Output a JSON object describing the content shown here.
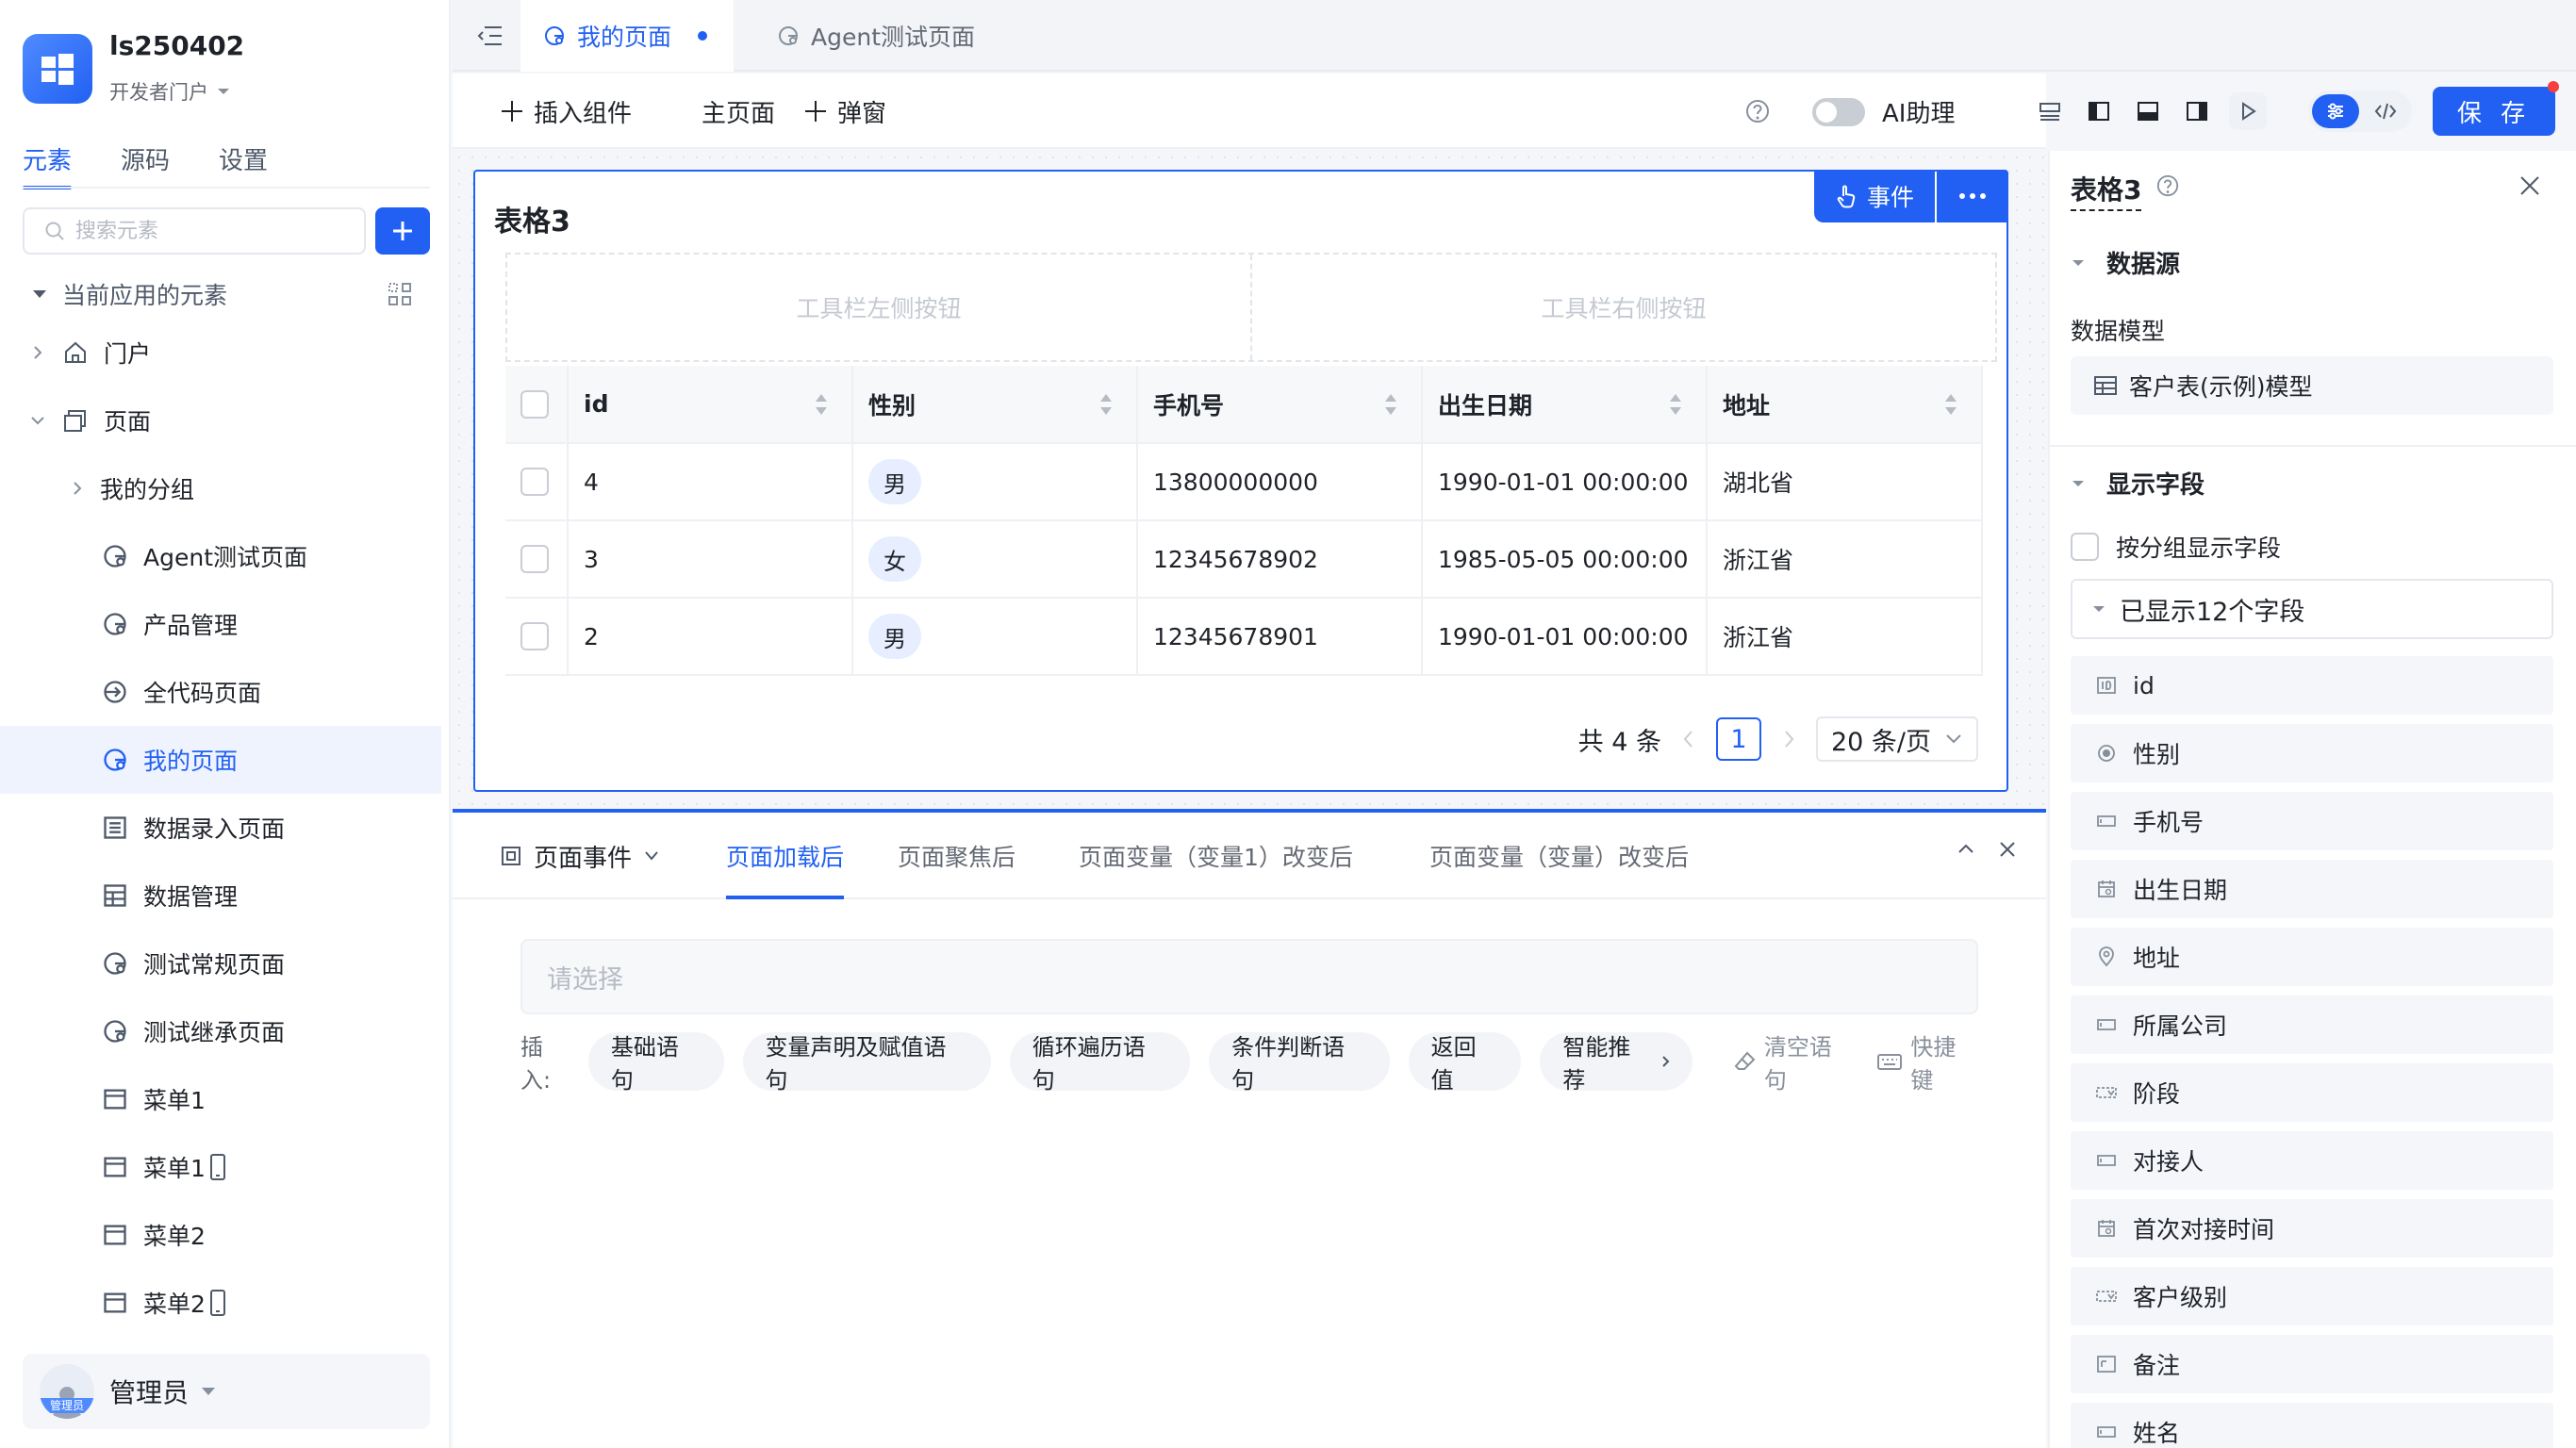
{
  "app": {
    "name": "ls250402",
    "portal": "开发者门户"
  },
  "sidebar": {
    "tabs": [
      {
        "label": "元素",
        "active": true
      },
      {
        "label": "源码",
        "active": false
      },
      {
        "label": "设置",
        "active": false
      }
    ],
    "search_placeholder": "搜索元素",
    "current_app_label": "当前应用的元素",
    "tree": {
      "portal": "门户",
      "pages": "页面",
      "group": "我的分组",
      "items": [
        {
          "label": "Agent测试页面",
          "icon": "page-icon"
        },
        {
          "label": "产品管理",
          "icon": "page-icon"
        },
        {
          "label": "全代码页面",
          "icon": "code-page-icon"
        },
        {
          "label": "我的页面",
          "icon": "page-icon",
          "selected": true
        },
        {
          "label": "数据录入页面",
          "icon": "form-icon"
        },
        {
          "label": "数据管理",
          "icon": "table-icon"
        },
        {
          "label": "测试常规页面",
          "icon": "page-icon"
        },
        {
          "label": "测试继承页面",
          "icon": "page-icon"
        },
        {
          "label": "菜单1",
          "icon": "menu-icon"
        },
        {
          "label": "菜单1",
          "icon": "menu-icon",
          "mobile": true
        },
        {
          "label": "菜单2",
          "icon": "menu-icon"
        },
        {
          "label": "菜单2",
          "icon": "menu-icon",
          "mobile": true
        }
      ]
    },
    "user": {
      "name": "管理员",
      "badge": "管理员"
    }
  },
  "tabs": [
    {
      "label": "我的页面",
      "active": true,
      "modified": true
    },
    {
      "label": "Agent测试页面",
      "active": false
    }
  ],
  "toolbar": {
    "insert_component": "插入组件",
    "main_page": "主页面",
    "popup": "弹窗",
    "ai_assistant": "AI助理",
    "save": "保 存"
  },
  "widget": {
    "title": "表格3",
    "event_label": "事件",
    "toolbar_left": "工具栏左侧按钮",
    "toolbar_right": "工具栏右侧按钮",
    "columns": [
      "id",
      "性别",
      "手机号",
      "出生日期",
      "地址"
    ],
    "rows": [
      {
        "id": "4",
        "gender": "男",
        "phone": "13800000000",
        "birth": "1990-01-01 00:00:00",
        "address": "湖北省"
      },
      {
        "id": "3",
        "gender": "女",
        "phone": "12345678902",
        "birth": "1985-05-05 00:00:00",
        "address": "浙江省"
      },
      {
        "id": "2",
        "gender": "男",
        "phone": "12345678901",
        "birth": "1990-01-01 00:00:00",
        "address": "浙江省"
      }
    ],
    "pagination": {
      "total": "共 4 条",
      "current": "1",
      "page_size": "20 条/页"
    }
  },
  "event_panel": {
    "page_event": "页面事件",
    "tabs": [
      {
        "label": "页面加载后",
        "active": true
      },
      {
        "label": "页面聚焦后",
        "active": false
      },
      {
        "label": "页面变量（变量1）改变后",
        "active": false
      },
      {
        "label": "页面变量（变量）改变后",
        "active": false
      }
    ],
    "select_placeholder": "请选择",
    "insert_label": "插入:",
    "insert_chips": [
      "基础语句",
      "变量声明及赋值语句",
      "循环遍历语句",
      "条件判断语句",
      "返回值",
      "智能推荐"
    ],
    "clear": "清空语句",
    "shortcuts": "快捷键"
  },
  "props": {
    "title": "表格3",
    "datasource": "数据源",
    "data_model_label": "数据模型",
    "data_model": "客户表(示例)模型",
    "display_fields": "显示字段",
    "group_display": "按分组显示字段",
    "shown_count": "已显示12个字段",
    "fields": [
      {
        "label": "id",
        "icon": "id-icon"
      },
      {
        "label": "性别",
        "icon": "radio-icon"
      },
      {
        "label": "手机号",
        "icon": "input-icon"
      },
      {
        "label": "出生日期",
        "icon": "date-icon"
      },
      {
        "label": "地址",
        "icon": "location-icon"
      },
      {
        "label": "所属公司",
        "icon": "input-icon"
      },
      {
        "label": "阶段",
        "icon": "select-icon"
      },
      {
        "label": "对接人",
        "icon": "input-icon"
      },
      {
        "label": "首次对接时间",
        "icon": "date-icon"
      },
      {
        "label": "客户级别",
        "icon": "select-icon"
      },
      {
        "label": "备注",
        "icon": "textarea-icon"
      },
      {
        "label": "姓名",
        "icon": "input-icon"
      }
    ]
  },
  "colors": {
    "accent": "#2160f3",
    "danger": "#f53f3f",
    "tag_bg": "#e6eeff"
  }
}
